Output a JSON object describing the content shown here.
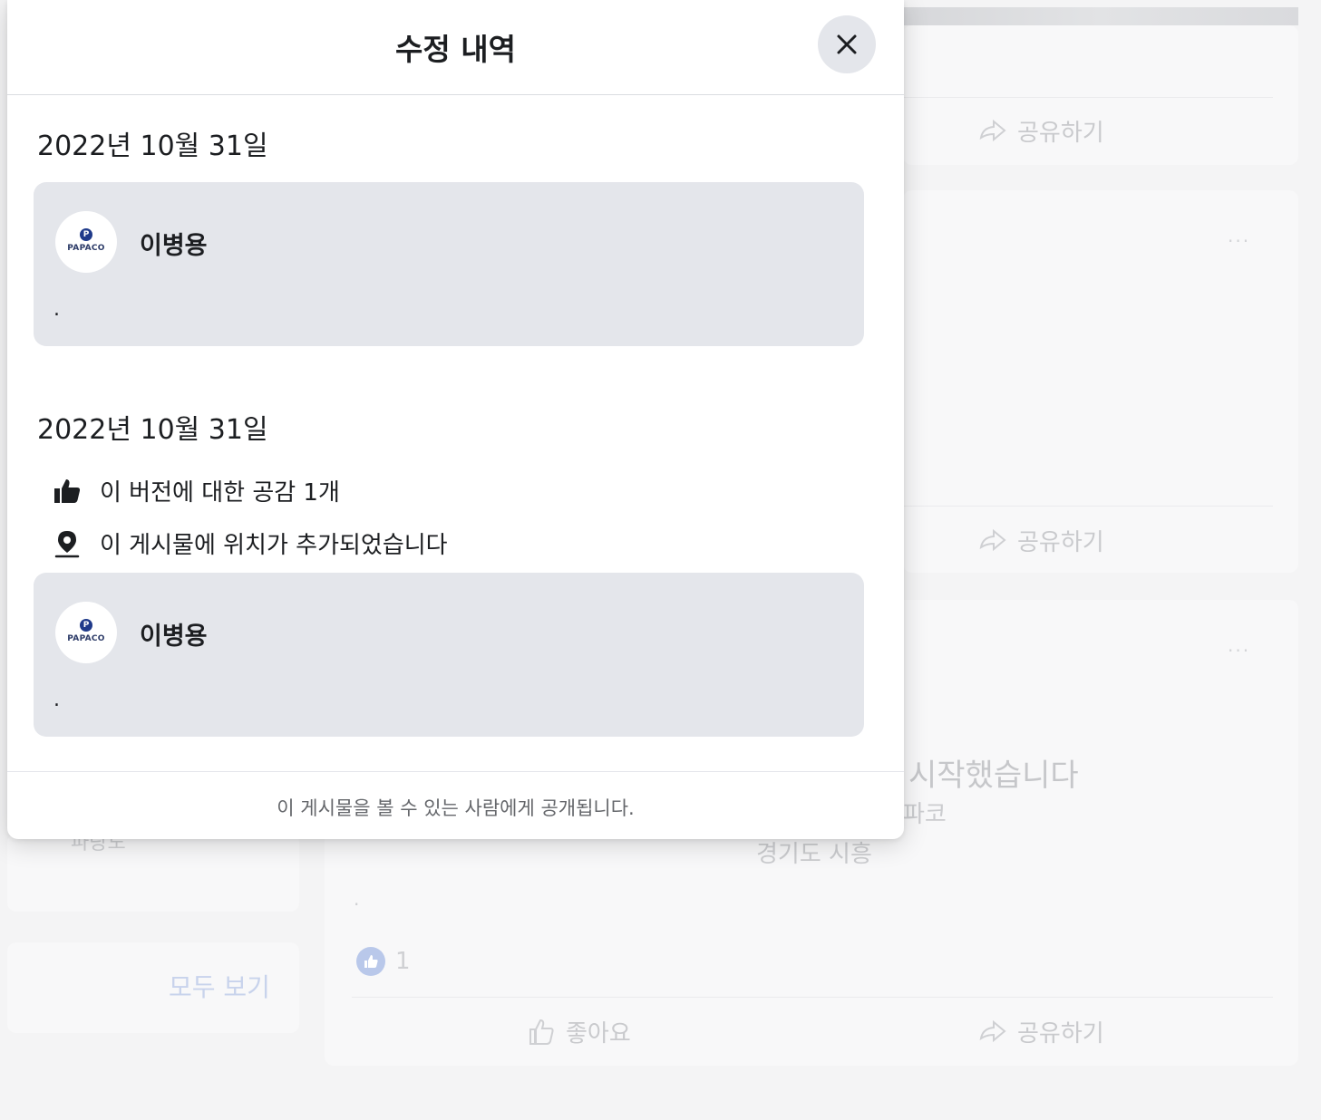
{
  "modal": {
    "title": "수정 내역",
    "close_label": "×",
    "footer_text": "이 게시물을 볼 수 있는 사람에게 공개됩니다."
  },
  "versions": [
    {
      "date": "2022년 10월 31일",
      "author": "이병용",
      "avatar_text": "PAPACO",
      "avatar_initial": "P",
      "body": "."
    },
    {
      "date": "2022년 10월 31일",
      "changes": [
        {
          "icon": "thumbs-up-icon",
          "text": "이 버전에 대한 공감 1개"
        },
        {
          "icon": "location-pin-icon",
          "text": "이 게시물에 위치가 추가되었습니다"
        }
      ],
      "author": "이병용",
      "avatar_text": "PAPACO",
      "avatar_initial": "P",
      "body": "."
    }
  ],
  "background_feed": {
    "share_label": "공유하기",
    "like_label": "좋아요",
    "see_all_label": "모두 보기",
    "post_headline": "시작했습니다",
    "post_sub": "파코",
    "post_location": "경기도 시흥",
    "sidebar_text": "파랑도",
    "post_dot": ".",
    "reaction_count": "1",
    "more_label": "···"
  },
  "colors": {
    "modal_bg": "#ffffff",
    "preview_bg": "#e4e6eb",
    "text_primary": "#1c1e21",
    "text_secondary": "#65676b",
    "brand": "#1f3a8a"
  }
}
